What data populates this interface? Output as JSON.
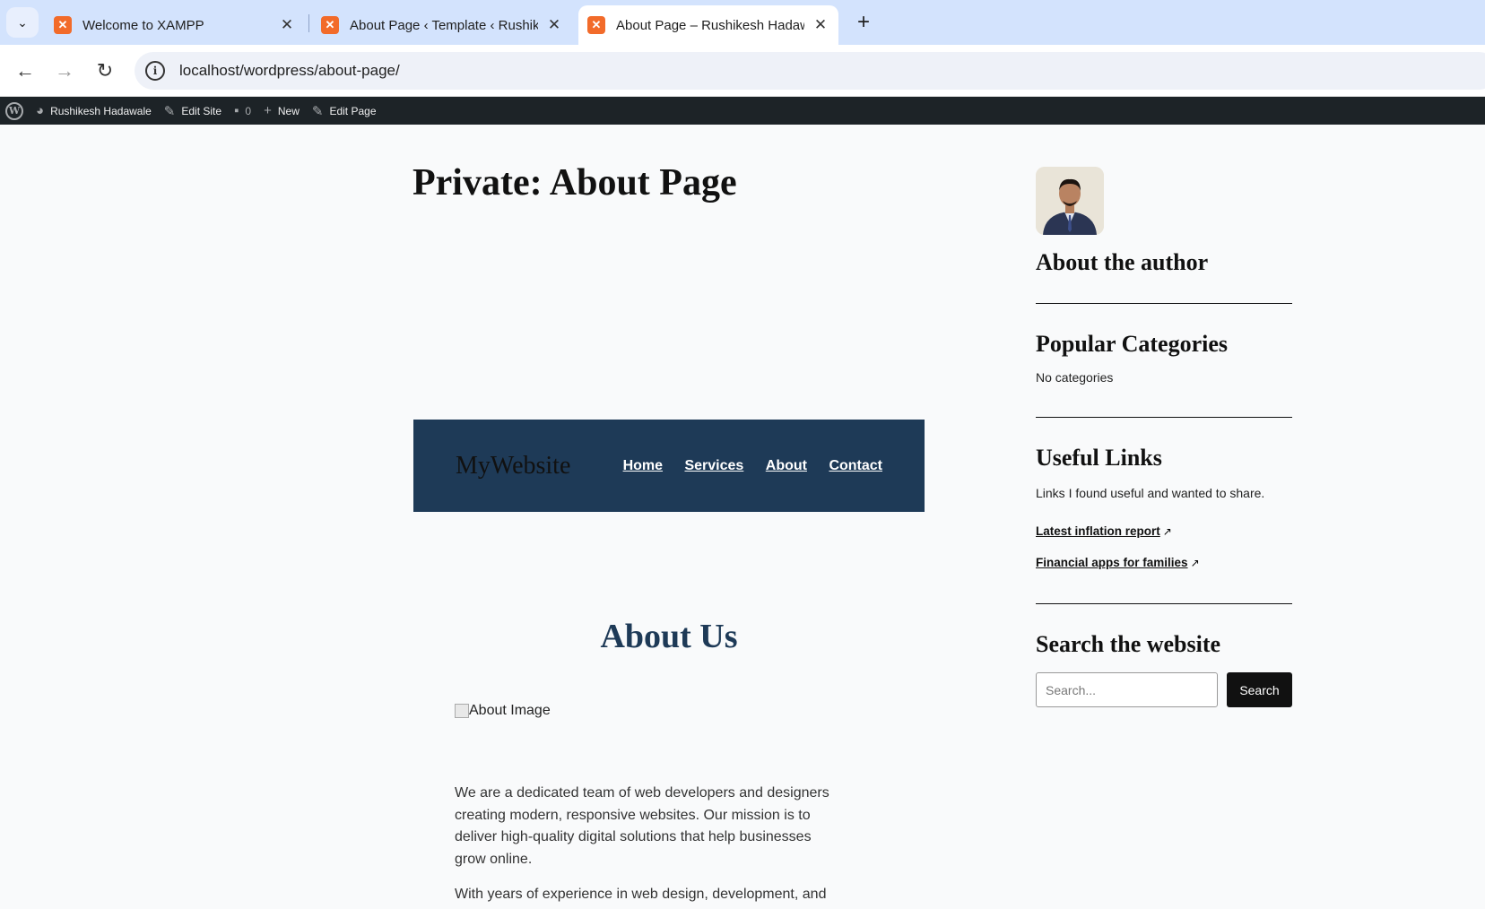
{
  "browser": {
    "tabs": [
      {
        "title": "Welcome to XAMPP",
        "active": false
      },
      {
        "title": "About Page ‹ Template ‹ Rushikesh Hadawale",
        "active": false
      },
      {
        "title": "About Page – Rushikesh Hadawale",
        "active": true
      }
    ],
    "url": "localhost/wordpress/about-page/"
  },
  "adminbar": {
    "site_name": "Rushikesh Hadawale",
    "edit_site": "Edit Site",
    "comments_count": "0",
    "new_label": "New",
    "edit_page": "Edit Page"
  },
  "page": {
    "title": "Private: About Page",
    "header": {
      "brand": "MyWebsite",
      "nav": [
        "Home",
        "Services",
        "About",
        "Contact"
      ],
      "background": "#1e3a57"
    },
    "about_heading": "About Us",
    "image_alt": "About Image",
    "paragraph1": "We are a dedicated team of web developers and designers creating modern, responsive websites. Our mission is to deliver high-quality digital solutions that help businesses grow online.",
    "paragraph2": "With years of experience in web design, development, and"
  },
  "sidebar": {
    "author_heading": "About the author",
    "categories_heading": "Popular Categories",
    "categories_text": "No categories",
    "links_heading": "Useful Links",
    "links_text": "Links I found useful and wanted to share.",
    "links": [
      "Latest inflation report",
      "Financial apps for families"
    ],
    "search_heading": "Search the website",
    "search_placeholder": "Search...",
    "search_button": "Search"
  }
}
